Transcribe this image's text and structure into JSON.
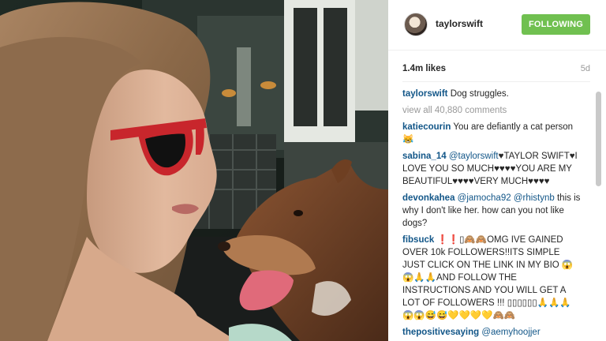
{
  "post": {
    "username": "taylorswift",
    "follow_label": "FOLLOWING",
    "likes": "1.4m likes",
    "age": "5d",
    "caption_user": "taylorswift",
    "caption_text": " Dog struggles.",
    "view_all": "view all 40,880 comments"
  },
  "comments": [
    {
      "user": "katiecourin",
      "parts": [
        {
          "t": " You are defiantly a cat person😹"
        }
      ]
    },
    {
      "user": "sabina_14",
      "parts": [
        {
          "m": " @taylorswift"
        },
        {
          "t": "♥TAYLOR SWIFT♥I LOVE YOU SO MUCH♥♥♥♥YOU ARE MY BEAUTIFUL♥♥♥♥VERY MUCH♥♥♥♥"
        }
      ]
    },
    {
      "user": "devonkahea",
      "parts": [
        {
          "m": " @jamocha92"
        },
        {
          "t": " "
        },
        {
          "m": "@rhistynb"
        },
        {
          "t": " this is why I don't like her. how can you not like dogs?"
        }
      ]
    },
    {
      "user": "fibsuck",
      "parts": [
        {
          "t": " ❗❗▯🙈🙈OMG IVE GAINED OVER 10k FOLLOWERS!!ITS SIMPLE JUST CLICK ON THE LINK IN MY BIO 😱😱🙏🙏AND FOLLOW THE INSTRUCTIONS AND YOU WILL GET A LOT OF FOLLOWERS !!! ▯▯▯▯▯▯🙏🙏🙏😱😱😅😅💛💛💛💛🙈🙈"
        }
      ]
    },
    {
      "user": "thepositivesaying",
      "parts": [
        {
          "m": " @aemyhoojjer"
        }
      ]
    }
  ],
  "colors": {
    "follow_green": "#70c050",
    "link_blue": "#125688",
    "muted_gray": "#999999"
  }
}
